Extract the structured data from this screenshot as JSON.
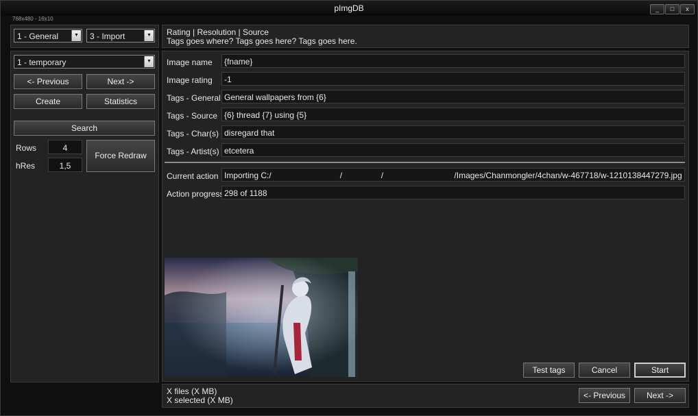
{
  "window": {
    "title": "pImgDB",
    "size_info": "768x480 - 16x10",
    "controls": {
      "minimize": "_",
      "maximize": "□",
      "close": "x"
    }
  },
  "left": {
    "combo_general": "1 - General",
    "combo_import": "3 - Import",
    "combo_folder": "1 - temporary",
    "previous_label": "<- Previous",
    "next_label": "Next ->",
    "create_label": "Create",
    "statistics_label": "Statistics",
    "search_label": "Search",
    "rows_label": "Rows",
    "rows_value": "4",
    "hres_label": "hRes",
    "hres_value": "1,5",
    "force_redraw_label": "Force Redraw"
  },
  "header": {
    "line1": "Rating | Resolution | Source",
    "line2": "Tags goes where?  Tags goes here?  Tags goes here."
  },
  "form": {
    "fields": [
      {
        "label": "Image name",
        "value": "{fname}"
      },
      {
        "label": "Image rating",
        "value": "-1"
      },
      {
        "label": "Tags - General",
        "value": "General wallpapers from {6}"
      },
      {
        "label": "Tags - Source",
        "value": "{6} thread {7} using {5}"
      },
      {
        "label": "Tags - Char(s)",
        "value": "disregard that"
      },
      {
        "label": "Tags - Artist(s)",
        "value": "etcetera"
      }
    ],
    "current_action_label": "Current action",
    "current_action_value": "Importing C:/                              /                 /                               /Images/Chanmongler/4chan/w-467718/w-1210138447279.jpg",
    "progress_label": "Action progress",
    "progress_value": "298 of 1188"
  },
  "actions": {
    "test_tags_label": "Test tags",
    "cancel_label": "Cancel",
    "start_label": "Start"
  },
  "footer": {
    "files_text": "X files (X MB)",
    "selected_text": "X selected (X MB)",
    "previous_label": "<- Previous",
    "next_label": "Next ->"
  }
}
